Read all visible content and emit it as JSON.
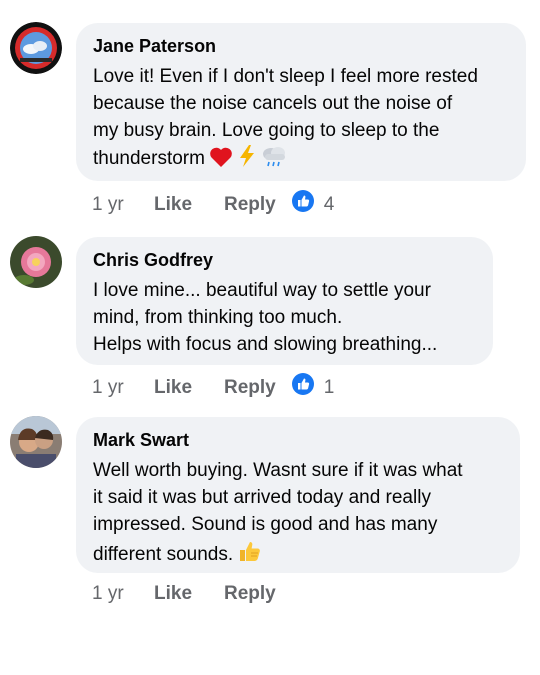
{
  "colors": {
    "bubble": "#f0f2f5",
    "like_blue": "#1877f2",
    "meta_gray": "#65676b"
  },
  "comments": [
    {
      "author": "Jane Paterson",
      "text": "Love it! Even if I don't sleep I feel more rested\nbecause the noise cancels out the noise of\nmy busy brain. Love going to sleep to the\nthunderstorm",
      "emojis": [
        "heart-emoji",
        "lightning-emoji",
        "rain-cloud-emoji"
      ],
      "time": "1 yr",
      "like": "Like",
      "reply": "Reply",
      "reactions": "4"
    },
    {
      "author": "Chris Godfrey",
      "text": "I love mine... beautiful way to settle your\nmind, from thinking too much.\nHelps with focus and slowing breathing...",
      "time": "1 yr",
      "like": "Like",
      "reply": "Reply",
      "reactions": "1"
    },
    {
      "author": "Mark Swart",
      "text": "Well worth buying. Wasnt sure if it was what\nit said it was but arrived today and really\nimpressed. Sound is good and has many\ndifferent sounds.",
      "emojis": [
        "thumbs-up-emoji"
      ],
      "time": "1 yr",
      "like": "Like",
      "reply": "Reply"
    }
  ]
}
